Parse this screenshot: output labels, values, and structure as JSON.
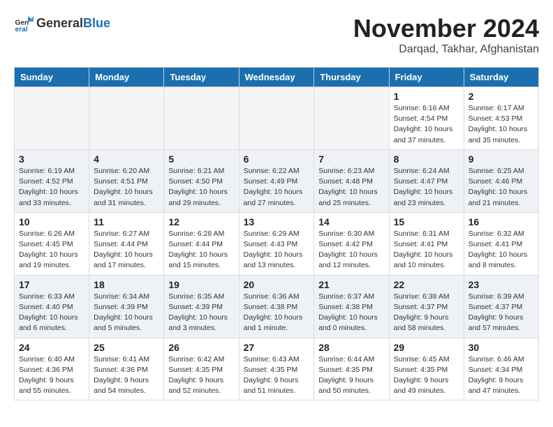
{
  "header": {
    "logo_general": "General",
    "logo_blue": "Blue",
    "month_year": "November 2024",
    "location": "Darqad, Takhar, Afghanistan"
  },
  "columns": [
    "Sunday",
    "Monday",
    "Tuesday",
    "Wednesday",
    "Thursday",
    "Friday",
    "Saturday"
  ],
  "weeks": [
    {
      "days": [
        {
          "num": "",
          "info": "",
          "empty": true
        },
        {
          "num": "",
          "info": "",
          "empty": true
        },
        {
          "num": "",
          "info": "",
          "empty": true
        },
        {
          "num": "",
          "info": "",
          "empty": true
        },
        {
          "num": "",
          "info": "",
          "empty": true
        },
        {
          "num": "1",
          "info": "Sunrise: 6:16 AM\nSunset: 4:54 PM\nDaylight: 10 hours\nand 37 minutes.",
          "empty": false
        },
        {
          "num": "2",
          "info": "Sunrise: 6:17 AM\nSunset: 4:53 PM\nDaylight: 10 hours\nand 35 minutes.",
          "empty": false
        }
      ]
    },
    {
      "days": [
        {
          "num": "3",
          "info": "Sunrise: 6:19 AM\nSunset: 4:52 PM\nDaylight: 10 hours\nand 33 minutes.",
          "empty": false
        },
        {
          "num": "4",
          "info": "Sunrise: 6:20 AM\nSunset: 4:51 PM\nDaylight: 10 hours\nand 31 minutes.",
          "empty": false
        },
        {
          "num": "5",
          "info": "Sunrise: 6:21 AM\nSunset: 4:50 PM\nDaylight: 10 hours\nand 29 minutes.",
          "empty": false
        },
        {
          "num": "6",
          "info": "Sunrise: 6:22 AM\nSunset: 4:49 PM\nDaylight: 10 hours\nand 27 minutes.",
          "empty": false
        },
        {
          "num": "7",
          "info": "Sunrise: 6:23 AM\nSunset: 4:48 PM\nDaylight: 10 hours\nand 25 minutes.",
          "empty": false
        },
        {
          "num": "8",
          "info": "Sunrise: 6:24 AM\nSunset: 4:47 PM\nDaylight: 10 hours\nand 23 minutes.",
          "empty": false
        },
        {
          "num": "9",
          "info": "Sunrise: 6:25 AM\nSunset: 4:46 PM\nDaylight: 10 hours\nand 21 minutes.",
          "empty": false
        }
      ]
    },
    {
      "days": [
        {
          "num": "10",
          "info": "Sunrise: 6:26 AM\nSunset: 4:45 PM\nDaylight: 10 hours\nand 19 minutes.",
          "empty": false
        },
        {
          "num": "11",
          "info": "Sunrise: 6:27 AM\nSunset: 4:44 PM\nDaylight: 10 hours\nand 17 minutes.",
          "empty": false
        },
        {
          "num": "12",
          "info": "Sunrise: 6:28 AM\nSunset: 4:44 PM\nDaylight: 10 hours\nand 15 minutes.",
          "empty": false
        },
        {
          "num": "13",
          "info": "Sunrise: 6:29 AM\nSunset: 4:43 PM\nDaylight: 10 hours\nand 13 minutes.",
          "empty": false
        },
        {
          "num": "14",
          "info": "Sunrise: 6:30 AM\nSunset: 4:42 PM\nDaylight: 10 hours\nand 12 minutes.",
          "empty": false
        },
        {
          "num": "15",
          "info": "Sunrise: 6:31 AM\nSunset: 4:41 PM\nDaylight: 10 hours\nand 10 minutes.",
          "empty": false
        },
        {
          "num": "16",
          "info": "Sunrise: 6:32 AM\nSunset: 4:41 PM\nDaylight: 10 hours\nand 8 minutes.",
          "empty": false
        }
      ]
    },
    {
      "days": [
        {
          "num": "17",
          "info": "Sunrise: 6:33 AM\nSunset: 4:40 PM\nDaylight: 10 hours\nand 6 minutes.",
          "empty": false
        },
        {
          "num": "18",
          "info": "Sunrise: 6:34 AM\nSunset: 4:39 PM\nDaylight: 10 hours\nand 5 minutes.",
          "empty": false
        },
        {
          "num": "19",
          "info": "Sunrise: 6:35 AM\nSunset: 4:39 PM\nDaylight: 10 hours\nand 3 minutes.",
          "empty": false
        },
        {
          "num": "20",
          "info": "Sunrise: 6:36 AM\nSunset: 4:38 PM\nDaylight: 10 hours\nand 1 minute.",
          "empty": false
        },
        {
          "num": "21",
          "info": "Sunrise: 6:37 AM\nSunset: 4:38 PM\nDaylight: 10 hours\nand 0 minutes.",
          "empty": false
        },
        {
          "num": "22",
          "info": "Sunrise: 6:38 AM\nSunset: 4:37 PM\nDaylight: 9 hours\nand 58 minutes.",
          "empty": false
        },
        {
          "num": "23",
          "info": "Sunrise: 6:39 AM\nSunset: 4:37 PM\nDaylight: 9 hours\nand 57 minutes.",
          "empty": false
        }
      ]
    },
    {
      "days": [
        {
          "num": "24",
          "info": "Sunrise: 6:40 AM\nSunset: 4:36 PM\nDaylight: 9 hours\nand 55 minutes.",
          "empty": false
        },
        {
          "num": "25",
          "info": "Sunrise: 6:41 AM\nSunset: 4:36 PM\nDaylight: 9 hours\nand 54 minutes.",
          "empty": false
        },
        {
          "num": "26",
          "info": "Sunrise: 6:42 AM\nSunset: 4:35 PM\nDaylight: 9 hours\nand 52 minutes.",
          "empty": false
        },
        {
          "num": "27",
          "info": "Sunrise: 6:43 AM\nSunset: 4:35 PM\nDaylight: 9 hours\nand 51 minutes.",
          "empty": false
        },
        {
          "num": "28",
          "info": "Sunrise: 6:44 AM\nSunset: 4:35 PM\nDaylight: 9 hours\nand 50 minutes.",
          "empty": false
        },
        {
          "num": "29",
          "info": "Sunrise: 6:45 AM\nSunset: 4:35 PM\nDaylight: 9 hours\nand 49 minutes.",
          "empty": false
        },
        {
          "num": "30",
          "info": "Sunrise: 6:46 AM\nSunset: 4:34 PM\nDaylight: 9 hours\nand 47 minutes.",
          "empty": false
        }
      ]
    }
  ]
}
